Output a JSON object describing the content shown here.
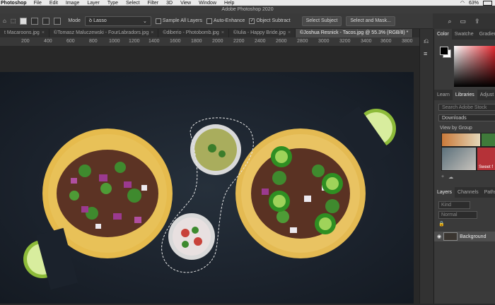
{
  "menubar": {
    "app": "Photoshop",
    "items": [
      "File",
      "Edit",
      "Image",
      "Layer",
      "Type",
      "Select",
      "Filter",
      "3D",
      "View",
      "Window",
      "Help"
    ],
    "battery": "63%"
  },
  "titlebar": {
    "title": "Adobe Photoshop 2020"
  },
  "options": {
    "mode_label": "Mode",
    "tool_value": "Lasso",
    "sample_all_layers": "Sample All Layers",
    "auto_enhance": "Auto-Enhance",
    "object_subtract": "Object Subtract",
    "select_subject": "Select Subject",
    "select_and_mask": "Select and Mask..."
  },
  "tabs": [
    {
      "label": "t Macaroons.jpg",
      "active": false
    },
    {
      "label": "©Tomasz Maluczewski - FourLabradors.jpg",
      "active": false
    },
    {
      "label": "©diberio - Photobomb.jpg",
      "active": false
    },
    {
      "label": "©Iulia - Happy Bride.jpg",
      "active": false
    },
    {
      "label": "©Joshua Resnick - Tacos.jpg @ 55.3% (RGB/8) *",
      "active": true
    }
  ],
  "ruler": [
    "200",
    "400",
    "600",
    "800",
    "1000",
    "1200",
    "1400",
    "1600",
    "1800",
    "2000",
    "2200",
    "2400",
    "2600",
    "2800",
    "3000",
    "3200",
    "3400",
    "3600",
    "3800"
  ],
  "panel": {
    "color_tabs": [
      "Color",
      "Swatche",
      "Gradien"
    ],
    "lib_tabs": [
      "Learn",
      "Libraries",
      "Adjust"
    ],
    "search_placeholder": "Search Adobe Stock",
    "library": "Downloads",
    "view_by": "View by Group",
    "thumb_caption": "Sweet f",
    "layer_tabs": [
      "Layers",
      "Channels",
      "Paths"
    ],
    "kind": "Kind",
    "blend": "Normal",
    "layer_name": "Background"
  }
}
